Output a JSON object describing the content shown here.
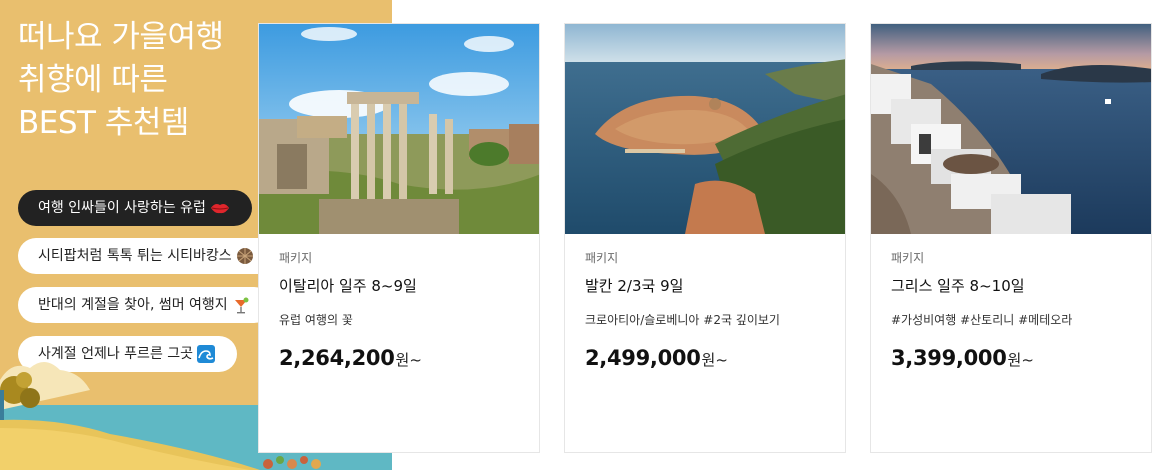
{
  "promo": {
    "title": "떠나요 가을여행\n취향에 따른\nBEST 추천템",
    "background": "#e9bf6e",
    "tags": [
      {
        "label": "여행 인싸들이 사랑하는 유럽",
        "emoji": "lips-icon",
        "active": true
      },
      {
        "label": "시티팝처럼 톡톡 튀는 시티바캉스",
        "emoji": "disco-ball-icon",
        "active": false
      },
      {
        "label": "반대의 계절을 찾아, 썸머 여행지",
        "emoji": "tropical-drink-icon",
        "active": false
      },
      {
        "label": "사계절 언제나 푸르른 그곳",
        "emoji": "wave-icon",
        "active": false
      }
    ]
  },
  "products": [
    {
      "category": "패키지",
      "name": "이탈리아 일주 8~9일",
      "desc": "유럽 여행의 꽃",
      "price": "2,264,200",
      "unit": "원~",
      "image": "roman-forum-photo"
    },
    {
      "category": "패키지",
      "name": "발칸 2/3국 9일",
      "desc": "크로아티아/슬로베니아 #2국 깊이보기",
      "price": "2,499,000",
      "unit": "원~",
      "image": "dubrovnik-photo"
    },
    {
      "category": "패키지",
      "name": "그리스 일주 8~10일",
      "desc": "#가성비여행 #산토리니 #메테오라",
      "price": "3,399,000",
      "unit": "원~",
      "image": "santorini-photo"
    }
  ]
}
